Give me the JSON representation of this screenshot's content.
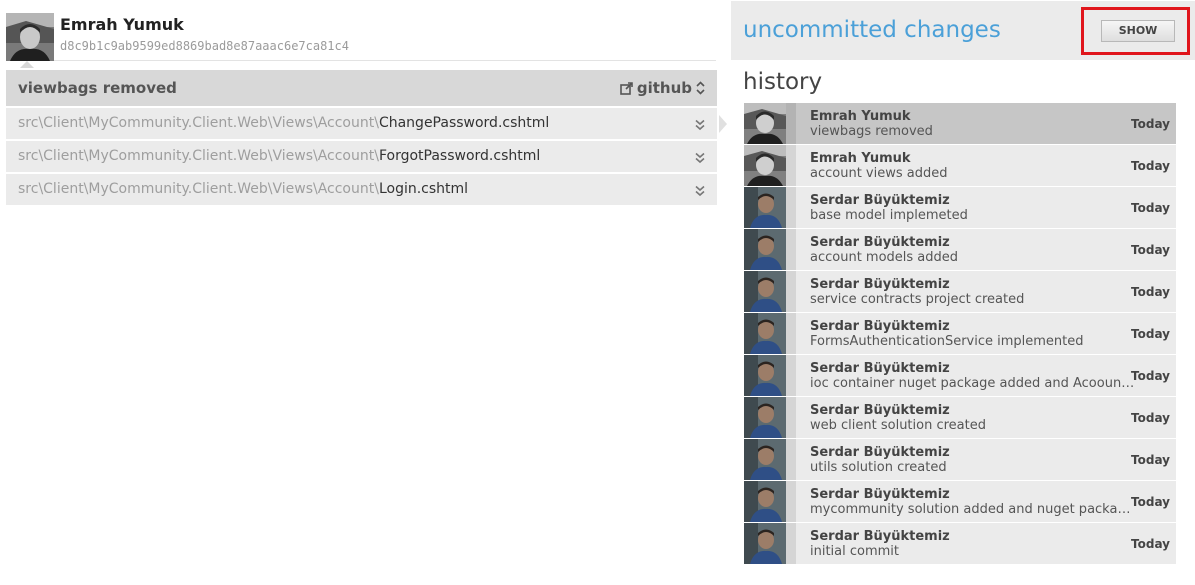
{
  "commit": {
    "author": "Emrah Yumuk",
    "sha": "d8c9b1c9ab9599ed8869bad8e87aaac6e7ca81c4",
    "message": "viewbags removed",
    "github_label": "github",
    "files": [
      {
        "dir": "src\\Client\\MyCommunity.Client.Web\\Views\\Account\\",
        "name": "ChangePassword.cshtml"
      },
      {
        "dir": "src\\Client\\MyCommunity.Client.Web\\Views\\Account\\",
        "name": "ForgotPassword.cshtml"
      },
      {
        "dir": "src\\Client\\MyCommunity.Client.Web\\Views\\Account\\",
        "name": "Login.cshtml"
      }
    ]
  },
  "uncommitted": {
    "title": "uncommitted changes",
    "show_label": "SHOW"
  },
  "history": {
    "title": "history",
    "items": [
      {
        "author": "Emrah Yumuk",
        "message": "viewbags removed",
        "date": "Today",
        "avatar": "emrah",
        "selected": true
      },
      {
        "author": "Emrah Yumuk",
        "message": "account views added",
        "date": "Today",
        "avatar": "emrah",
        "selected": false
      },
      {
        "author": "Serdar Büyüktemiz",
        "message": "base model implemeted",
        "date": "Today",
        "avatar": "serdar",
        "selected": false
      },
      {
        "author": "Serdar Büyüktemiz",
        "message": "account models added",
        "date": "Today",
        "avatar": "serdar",
        "selected": false
      },
      {
        "author": "Serdar Büyüktemiz",
        "message": "service contracts project created",
        "date": "Today",
        "avatar": "serdar",
        "selected": false
      },
      {
        "author": "Serdar Büyüktemiz",
        "message": "FormsAuthenticationService implemented",
        "date": "Today",
        "avatar": "serdar",
        "selected": false
      },
      {
        "author": "Serdar Büyüktemiz",
        "message": "ioc container nuget package added and Acoount Controller",
        "date": "Today",
        "avatar": "serdar",
        "selected": false
      },
      {
        "author": "Serdar Büyüktemiz",
        "message": "web client solution created",
        "date": "Today",
        "avatar": "serdar",
        "selected": false
      },
      {
        "author": "Serdar Büyüktemiz",
        "message": "utils solution created",
        "date": "Today",
        "avatar": "serdar",
        "selected": false
      },
      {
        "author": "Serdar Büyüktemiz",
        "message": "mycommunity solution added and nuget package restore enabled",
        "date": "Today",
        "avatar": "serdar",
        "selected": false
      },
      {
        "author": "Serdar Büyüktemiz",
        "message": "initial commit",
        "date": "Today",
        "avatar": "serdar",
        "selected": false
      }
    ]
  },
  "colors": {
    "accent": "#4ba0d8",
    "highlight": "#e0161c",
    "selected_row": "#c6c6c6",
    "row": "#ebebeb"
  },
  "icons": {
    "external_link": "external-link-icon",
    "select_arrows": "chevron-up-down-icon",
    "expand": "double-chevron-down-icon"
  }
}
